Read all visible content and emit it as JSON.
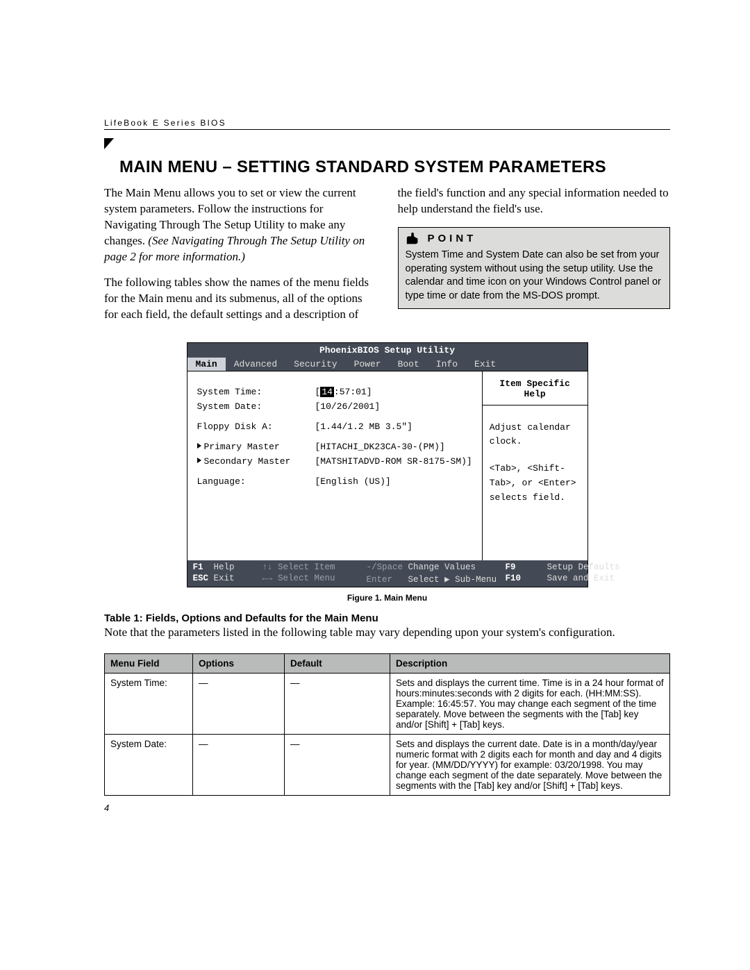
{
  "header": "LifeBook E Series BIOS",
  "title": "MAIN MENU – SETTING STANDARD SYSTEM PARAMETERS",
  "para1": "The Main Menu allows you to set or view the current system parameters. Follow the instructions for Navigating Through The Setup Utility to make any changes.",
  "para1_ital": "(See Navigating Through The Setup Utility on page 2 for more information.)",
  "para2": "The following tables show the names of the menu fields for the Main menu and its submenus, all of the options for each field, the default settings and a description of",
  "para3": "the field's function and any special information needed to help understand the field's use.",
  "point": {
    "label": "POINT",
    "body": "System Time and System Date can also be set from your operating system without using the setup utility. Use the calendar and time icon on your Windows Control panel or type time or date from the MS-DOS prompt."
  },
  "bios": {
    "title": "PhoenixBIOS Setup Utility",
    "tabs": [
      "Main",
      "Advanced",
      "Security",
      "Power",
      "Boot",
      "Info",
      "Exit"
    ],
    "active_tab": 0,
    "fields": {
      "time_label": "System Time:",
      "time_hh": "14",
      "time_rest": ":57:01]",
      "date_label": "System Date:",
      "date_value": "[10/26/2001]",
      "floppy_label": "Floppy Disk A:",
      "floppy_value": "[1.44/1.2 MB 3.5\"]",
      "pm_label": "Primary Master",
      "pm_value": "[HITACHI_DK23CA-30-(PM)]",
      "sm_label": "Secondary Master",
      "sm_value": "[MATSHITADVD-ROM SR-8175-SM)]",
      "lang_label": "Language:",
      "lang_value": "[English (US)]"
    },
    "help_title": "Item Specific Help",
    "help_body1": "Adjust calendar clock.",
    "help_body2": "<Tab>, <Shift-Tab>, or <Enter> selects field.",
    "footer": {
      "f1": "F1",
      "help": "Help",
      "updown": "↑↓",
      "select_item": "Select Item",
      "minus_space": "-/Space",
      "change_values": "Change Values",
      "f9": "F9",
      "setup_defaults": "Setup Defaults",
      "esc": "ESC",
      "exit": "Exit",
      "leftright": "←→",
      "select_menu": "Select Menu",
      "enter": "Enter",
      "select_sub": "Select ▶ Sub-Menu",
      "f10": "F10",
      "save_exit": "Save and Exit"
    }
  },
  "fig_caption": "Figure 1.  Main Menu",
  "table_title": "Table 1: Fields, Options and Defaults for the Main Menu",
  "table_note": "Note that the parameters listed in the following table may vary depending upon your system's configuration.",
  "table": {
    "headers": [
      "Menu Field",
      "Options",
      "Default",
      "Description"
    ],
    "rows": [
      {
        "field": "System Time:",
        "options": "—",
        "default": "—",
        "desc": "Sets and displays the current time. Time is in a 24 hour format of hours:minutes:seconds with 2 digits for each. (HH:MM:SS). Example: 16:45:57. You may change each segment of the time separately. Move between the segments with the [Tab] key and/or [Shift] + [Tab] keys."
      },
      {
        "field": "System Date:",
        "options": "—",
        "default": "—",
        "desc": "Sets and displays the current date. Date is in a month/day/year numeric format with 2 digits each for month and day and 4 digits for year. (MM/DD/YYYY) for example: 03/20/1998. You may change each segment of the date separately. Move between the segments with the [Tab] key and/or [Shift] + [Tab] keys."
      }
    ]
  },
  "page_number": "4"
}
